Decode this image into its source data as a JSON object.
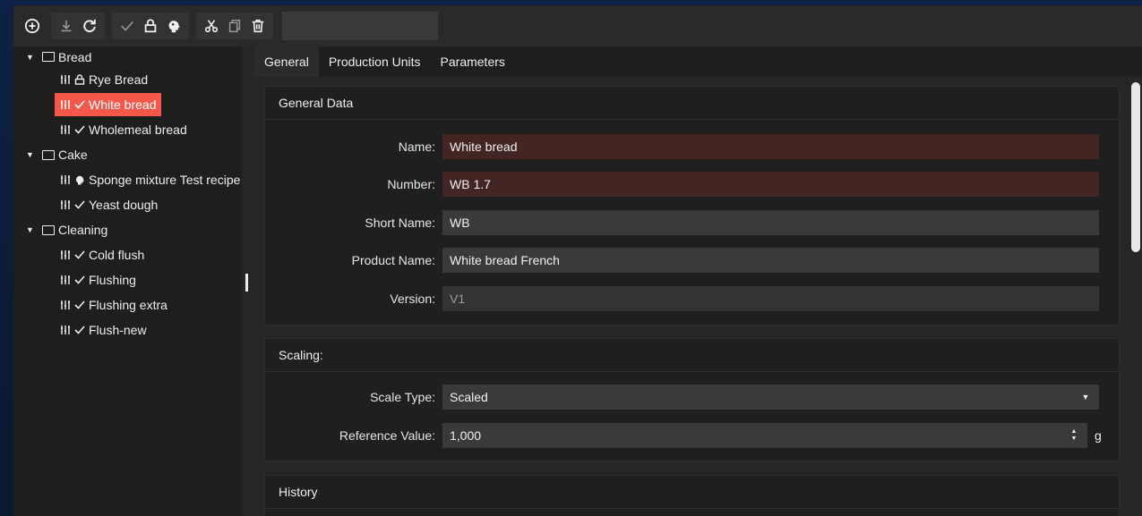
{
  "toolbar": {
    "buttons": [
      {
        "name": "add-icon"
      },
      {
        "name": "download-icon"
      },
      {
        "name": "refresh-icon"
      },
      {
        "name": "check-icon"
      },
      {
        "name": "lock-icon"
      },
      {
        "name": "brain-icon"
      },
      {
        "name": "cut-icon"
      },
      {
        "name": "copy-icon"
      },
      {
        "name": "delete-icon"
      }
    ],
    "search_value": ""
  },
  "tree": {
    "folders": [
      {
        "label": "Bread",
        "items": [
          {
            "label": "Rye Bread",
            "status": "lock"
          },
          {
            "label": "White bread",
            "status": "check",
            "selected": true
          },
          {
            "label": "Wholemeal bread",
            "status": "check"
          }
        ]
      },
      {
        "label": "Cake",
        "items": [
          {
            "label": "Sponge mixture Test recipe",
            "status": "brain"
          },
          {
            "label": "Yeast dough",
            "status": "check"
          }
        ]
      },
      {
        "label": "Cleaning",
        "items": [
          {
            "label": "Cold flush",
            "status": "check"
          },
          {
            "label": "Flushing",
            "status": "check"
          },
          {
            "label": "Flushing extra",
            "status": "check"
          },
          {
            "label": "Flush-new",
            "status": "check"
          }
        ]
      }
    ]
  },
  "tabs": [
    {
      "label": "General",
      "active": true
    },
    {
      "label": "Production Units"
    },
    {
      "label": "Parameters"
    }
  ],
  "general_data": {
    "title": "General Data",
    "fields": {
      "name": {
        "label": "Name:",
        "value": "White bread"
      },
      "number": {
        "label": "Number:",
        "value": "WB 1.7"
      },
      "short_name": {
        "label": "Short Name:",
        "value": "WB"
      },
      "product_name": {
        "label": "Product Name:",
        "value": "White bread French"
      },
      "version": {
        "label": "Version:",
        "value": "V1"
      }
    }
  },
  "scaling": {
    "title": "Scaling:",
    "scale_type": {
      "label": "Scale Type:",
      "value": "Scaled"
    },
    "reference_value": {
      "label": "Reference Value:",
      "value": "1,000",
      "unit": "g"
    }
  },
  "history": {
    "title": "History"
  },
  "colors": {
    "selected": "#f4584b",
    "error_field": "#432524",
    "field": "#3a3a3a"
  }
}
